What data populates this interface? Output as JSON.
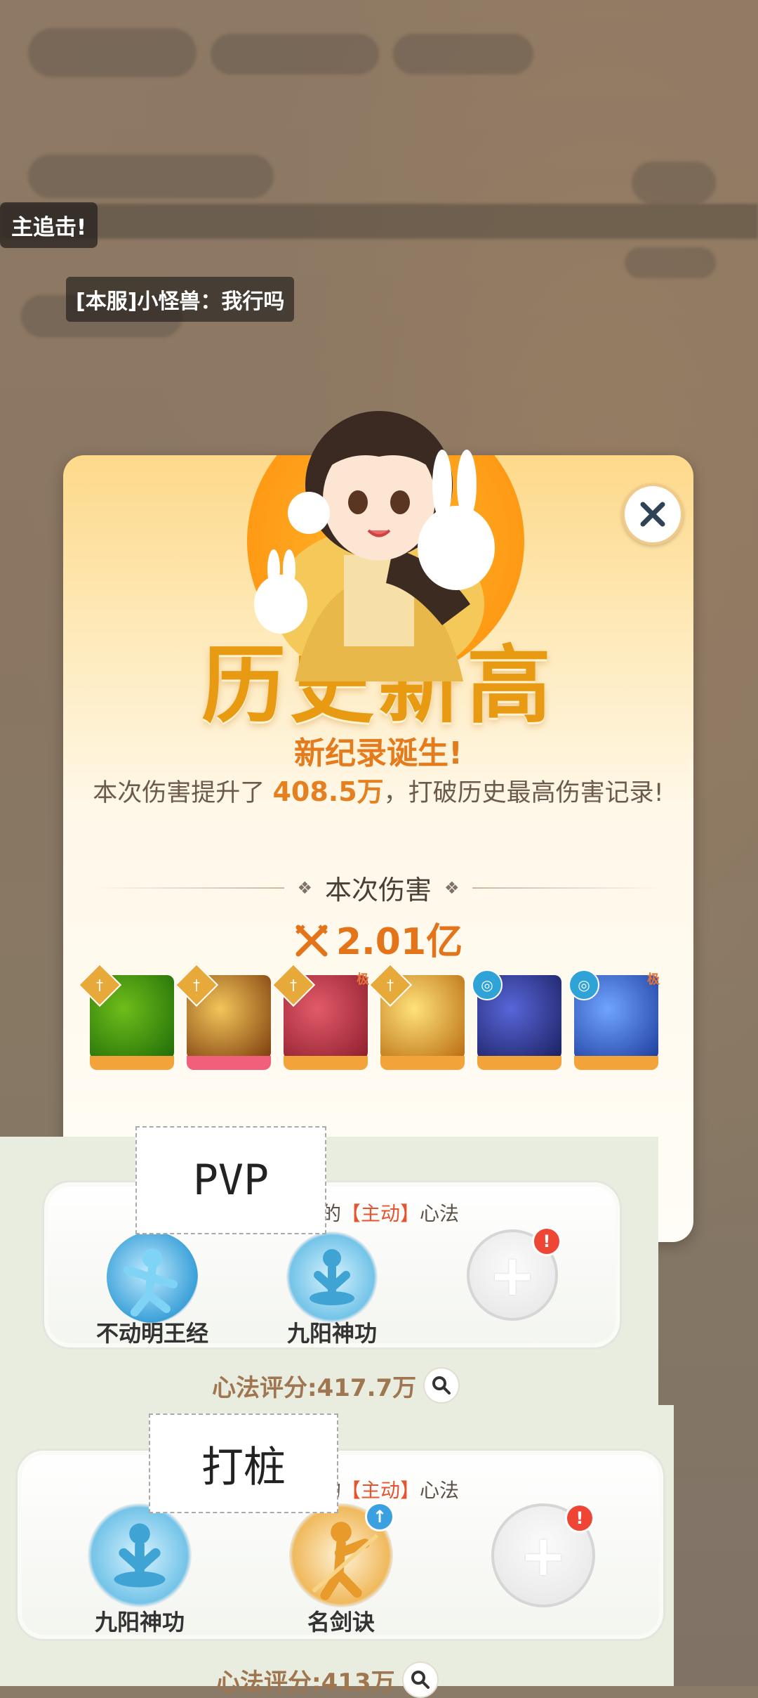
{
  "background": {
    "toast": "主追击!",
    "chat": "[本服]小怪兽：我行吗"
  },
  "popup": {
    "title": "历史新高",
    "subtitle": "新纪录诞生!",
    "desc_prefix": "本次伤害提升了 ",
    "desc_value": "408.5万",
    "desc_suffix": "，打破历史最高伤害记录!",
    "section_title": "本次伤害",
    "damage": "2.01亿",
    "skills": [
      {
        "name": "green-slash-skill",
        "badge": "sword",
        "colors": [
          "#6fbd1a",
          "#1e6b09"
        ],
        "base": "orange"
      },
      {
        "name": "golden-spears-skill",
        "badge": "sword",
        "colors": [
          "#f2c55a",
          "#7a3a0b"
        ],
        "base": "red"
      },
      {
        "name": "red-swords-skill",
        "badge": "sword",
        "colors": [
          "#e35a6a",
          "#8c1e2c"
        ],
        "base": "orange",
        "tag": "极"
      },
      {
        "name": "golden-blade-skill",
        "badge": "sword",
        "colors": [
          "#ffe27a",
          "#b86a0f"
        ],
        "base": "orange"
      },
      {
        "name": "blue-orb-skill",
        "badge": "swirl",
        "colors": [
          "#5866d9",
          "#1a1f5e"
        ],
        "base": "orange"
      },
      {
        "name": "ice-palm-skill",
        "badge": "swirl",
        "colors": [
          "#6fa4ff",
          "#1e3c9c"
        ],
        "base": "orange",
        "tag": "极"
      }
    ]
  },
  "pvp": {
    "note": "PVP",
    "title_prefix": "的",
    "title_active": "【主动】",
    "title_suffix": "心法",
    "skill1": "不动明王经",
    "skill2": "九阳神功",
    "score": "心法评分:417.7万"
  },
  "dummy": {
    "note": "打桩",
    "title_prefix": "的",
    "title_active": "【主动】",
    "title_suffix": "心法",
    "skill1": "九阳神功",
    "skill2": "名剑诀",
    "score": "心法评分:413万"
  }
}
